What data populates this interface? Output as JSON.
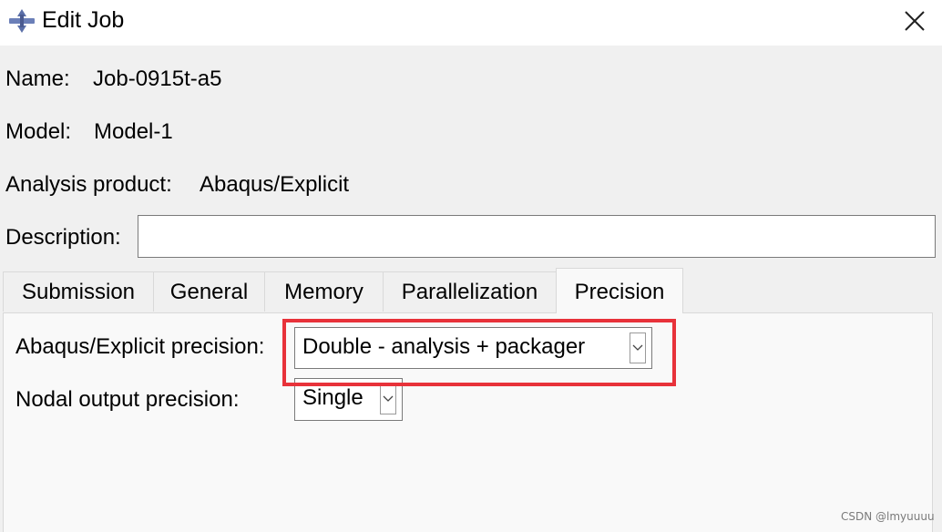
{
  "window": {
    "title": "Edit Job",
    "app_icon": "abaqus-logo-icon",
    "close_icon": "close-icon"
  },
  "fields": {
    "name_label": "Name:",
    "name_value": "Job-0915t-a5",
    "model_label": "Model:",
    "model_value": "Model-1",
    "product_label": "Analysis product:",
    "product_value": "Abaqus/Explicit",
    "description_label": "Description:",
    "description_value": ""
  },
  "tabs": [
    {
      "label": "Submission",
      "active": false
    },
    {
      "label": "General",
      "active": false
    },
    {
      "label": "Memory",
      "active": false
    },
    {
      "label": "Parallelization",
      "active": false
    },
    {
      "label": "Precision",
      "active": true
    }
  ],
  "precision": {
    "explicit_label": "Abaqus/Explicit precision:",
    "explicit_value": "Double - analysis + packager",
    "nodal_label": "Nodal output precision:",
    "nodal_value": "Single"
  },
  "highlight_color": "#e8323a",
  "watermark": "CSDN @lmyuuuu"
}
